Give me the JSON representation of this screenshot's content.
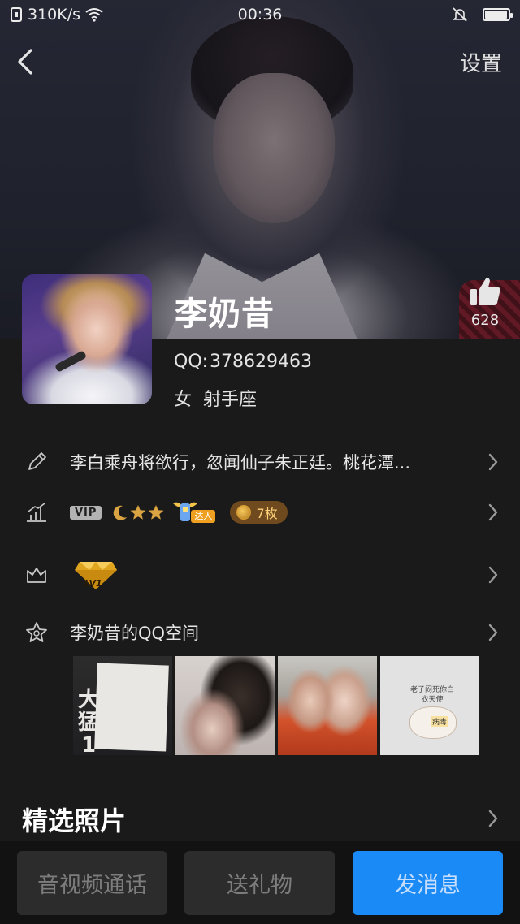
{
  "status_bar": {
    "speed": "310K/s",
    "time": "00:36",
    "battery_level": 0.95
  },
  "nav": {
    "settings_label": "设置"
  },
  "profile": {
    "name": "李奶昔",
    "likes": "628",
    "qq_label": "QQ:",
    "qq_number": "378629463",
    "gender": "女",
    "zodiac": "射手座"
  },
  "rows": {
    "signature": "李白乘舟将欲行，忽闻仙子朱正廷。桃花潭...",
    "vip_label": "VIP",
    "daren_label": "达人",
    "medal_count": "7枚",
    "gem_level": "LV1",
    "qzone_label": "李奶昔的QQ空间"
  },
  "photos": {
    "p1_big_text": "大猛1",
    "p4_text": "老子闷死你白衣天使",
    "p4_tag": "病毒"
  },
  "section": {
    "featured_title": "精选照片"
  },
  "bottom_bar": {
    "call_label": "音视频通话",
    "gift_label": "送礼物",
    "message_label": "发消息"
  },
  "icons": {
    "back": "chevron-left-icon",
    "like": "thumb-up-icon",
    "edit": "pencil-icon",
    "level": "chart-up-icon",
    "crown": "crown-icon",
    "star": "star-icon"
  },
  "colors": {
    "accent": "#1a8af7",
    "background": "#1a1a1a",
    "medal_pill": "#6e4a1e"
  }
}
